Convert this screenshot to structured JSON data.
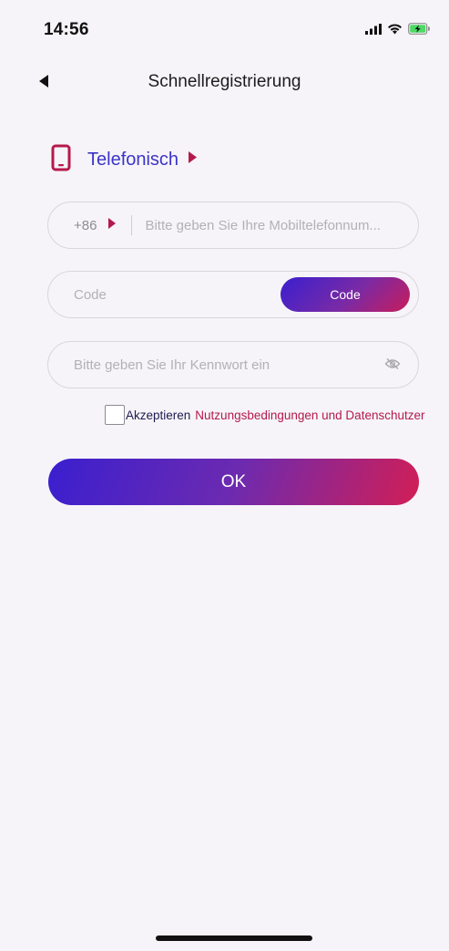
{
  "status_bar": {
    "time": "14:56",
    "icons": [
      "signal-icon",
      "wifi-icon",
      "battery-charging-icon"
    ]
  },
  "nav": {
    "title": "Schnellregistrierung",
    "back_icon": "back-arrow-icon"
  },
  "method": {
    "icon": "phone-icon",
    "label": "Telefonisch",
    "arrow_icon": "triangle-right-icon"
  },
  "phone_field": {
    "country_code": "+86",
    "placeholder": "Bitte geben Sie Ihre Mobiltelefonnum..."
  },
  "code_field": {
    "placeholder": "Code",
    "button_label": "Code"
  },
  "password_field": {
    "placeholder": "Bitte geben Sie Ihr Kennwort ein",
    "toggle_icon": "eye-off-icon"
  },
  "terms": {
    "checked": false,
    "prefix": "Akzeptieren",
    "link_text": "Nutzungsbedingungen und Datenschutzer"
  },
  "submit": {
    "label": "OK"
  },
  "colors": {
    "accent_blue": "#3b34c9",
    "accent_magenta": "#b5194c",
    "gradient_start": "#3a1fcf",
    "gradient_end": "#d21e55",
    "background": "#f6f4f8"
  }
}
